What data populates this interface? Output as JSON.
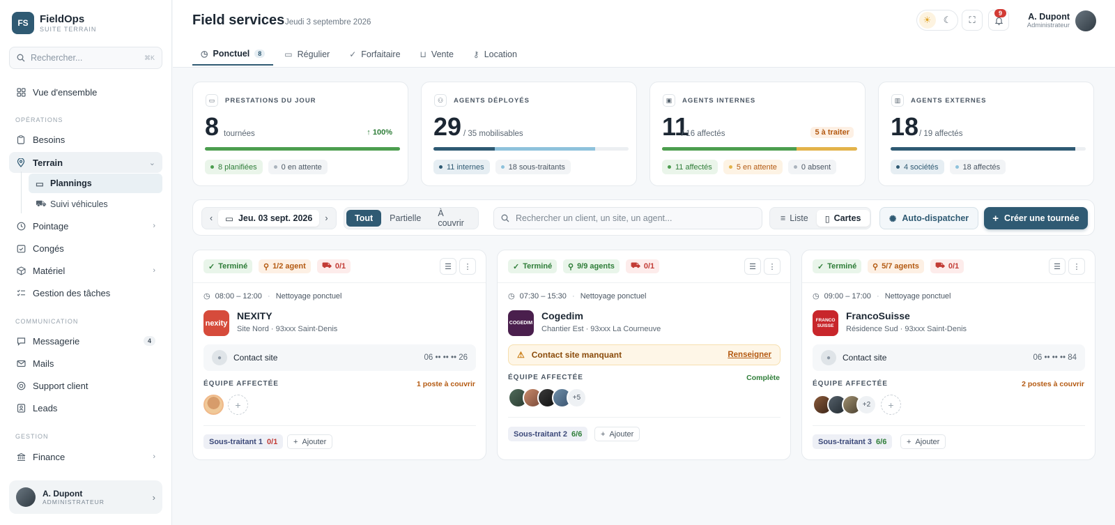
{
  "sidebar": {
    "logo": "FS",
    "brand": "FieldOps",
    "brand_sub": "SUITE TERRAIN",
    "search_placeholder": "Rechercher...",
    "search_kbd": "⌘K",
    "overview": "Vue d'ensemble",
    "section_ops": "OPÉRATIONS",
    "besoins": "Besoins",
    "terrain": "Terrain",
    "plannings": "Plannings",
    "vehicules": "Suivi véhicules",
    "pointage": "Pointage",
    "conges": "Congés",
    "materiel": "Matériel",
    "taches": "Gestion des tâches",
    "section_comm": "COMMUNICATION",
    "messagerie": "Messagerie",
    "messagerie_count": "4",
    "mails": "Mails",
    "support": "Support client",
    "leads": "Leads",
    "section_gestion": "GESTION",
    "finance": "Finance",
    "user_name": "A. Dupont",
    "user_role": "ADMINISTRATEUR"
  },
  "header": {
    "title": "Field services",
    "date": "Jeudi 3 septembre 2026",
    "notif_count": "9",
    "user_name": "A. Dupont",
    "user_role": "Administrateur"
  },
  "tabs": [
    {
      "label": "Ponctuel",
      "count": "8"
    },
    {
      "label": "Régulier"
    },
    {
      "label": "Forfaitaire"
    },
    {
      "label": "Vente"
    },
    {
      "label": "Location"
    }
  ],
  "stats": [
    {
      "label": "PRESTATIONS DU JOUR",
      "value": "8",
      "unit": "tournées",
      "right": "↑ 100%",
      "pills": [
        "8 planifiées",
        "0 en attente"
      ]
    },
    {
      "label": "AGENTS DÉPLOYÉS",
      "value": "29",
      "unit": "/ 35 mobilisables",
      "pills": [
        "11 internes",
        "18 sous-traitants"
      ]
    },
    {
      "label": "AGENTS INTERNES",
      "value": "11",
      "unit": "/ 16 affectés",
      "right": "5 à traiter",
      "pills": [
        "11 affectés",
        "5 en attente",
        "0 absent"
      ]
    },
    {
      "label": "AGENTS EXTERNES",
      "value": "18",
      "unit": "/ 19 affectés",
      "pills": [
        "4 sociétés",
        "18 affectés"
      ]
    }
  ],
  "stat_bars": {
    "prestations": 1.0,
    "deployes_internes": 0.314,
    "deployes_total": 0.829,
    "internes_affectes": 0.6875,
    "internes_total": 1.0,
    "externes": 0.947
  },
  "toolbar": {
    "date": "Jeu. 03 sept. 2026",
    "filter_all": "Tout",
    "filter_partial": "Partielle",
    "filter_cover": "À couvrir",
    "search_placeholder": "Rechercher un client, un site, un agent...",
    "view_list": "Liste",
    "view_cards": "Cartes",
    "auto_dispatch": "Auto-dispatcher",
    "create": "Créer une tournée"
  },
  "cards": [
    {
      "status": "Terminé",
      "agents": "1/2 agent",
      "vehicles": "0/1",
      "time": "08:00 – 12:00",
      "type": "Nettoyage ponctuel",
      "client": "NEXITY",
      "logo": "nexity",
      "site": "Site Nord · 93xxx Saint-Denis",
      "contact": "Contact site",
      "phone": "06 •• •• •• 26",
      "team_label": "ÉQUIPE AFFECTÉE",
      "team_status": "1 poste à couvrir",
      "subcontractor": "Sous-traitant 1",
      "sub_ratio": "0/1",
      "add": "Ajouter"
    },
    {
      "status": "Terminé",
      "agents": "9/9 agents",
      "vehicles": "0/1",
      "time": "07:30 – 15:30",
      "type": "Nettoyage ponctuel",
      "client": "Cogedim",
      "logo": "COGEDIM",
      "site": "Chantier Est · 93xxx La Courneuve",
      "warning": "Contact site manquant",
      "warning_link": "Renseigner",
      "team_label": "ÉQUIPE AFFECTÉE",
      "team_status": "Complète",
      "more": "+5",
      "subcontractor": "Sous-traitant 2",
      "sub_ratio": "6/6",
      "add": "Ajouter"
    },
    {
      "status": "Terminé",
      "agents": "5/7 agents",
      "vehicles": "0/1",
      "time": "09:00 – 17:00",
      "type": "Nettoyage ponctuel",
      "client": "FrancoSuisse",
      "logo": "FRANCO SUISSE",
      "site": "Résidence Sud · 93xxx Saint-Denis",
      "contact": "Contact site",
      "phone": "06 •• •• •• 84",
      "team_label": "ÉQUIPE AFFECTÉE",
      "team_status": "2 postes à couvrir",
      "more": "+2",
      "subcontractor": "Sous-traitant 3",
      "sub_ratio": "6/6",
      "add": "Ajouter"
    }
  ],
  "colors": {
    "accent": "#2f5a73",
    "success": "#4c9e4f",
    "warning": "#e3b34a",
    "danger": "#c23b35"
  }
}
